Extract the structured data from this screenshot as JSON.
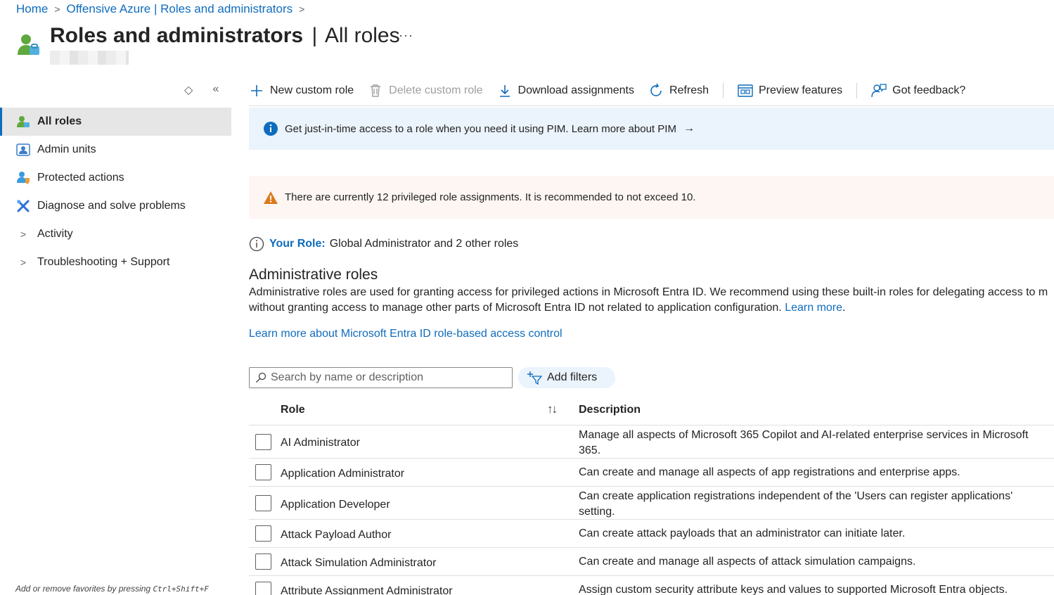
{
  "breadcrumb": {
    "home": "Home",
    "parent": "Offensive Azure | Roles and administrators"
  },
  "page": {
    "title_main": "Roles and administrators",
    "title_divider": "|",
    "title_sub": "All roles",
    "more": "···"
  },
  "nav": {
    "items": [
      {
        "label": "All roles",
        "icon": "roles-icon"
      },
      {
        "label": "Admin units",
        "icon": "admin-units-icon"
      },
      {
        "label": "Protected actions",
        "icon": "protected-actions-icon"
      },
      {
        "label": "Diagnose and solve problems",
        "icon": "wrench-icon"
      },
      {
        "label": "Activity",
        "icon": "chevron-right-icon"
      },
      {
        "label": "Troubleshooting + Support",
        "icon": "chevron-right-icon"
      }
    ],
    "hint_prefix": "Add or remove favorites by pressing",
    "hint_keys": "Ctrl+Shift+F"
  },
  "toolbar": {
    "new_custom_role": "New custom role",
    "delete_custom_role": "Delete custom role",
    "download_assignments": "Download assignments",
    "refresh": "Refresh",
    "preview_features": "Preview features",
    "got_feedback": "Got feedback?"
  },
  "banners": {
    "info": "Get just-in-time access to a role when you need it using PIM. Learn more about PIM",
    "info_arrow": "→",
    "warning": "There are currently 12 privileged role assignments. It is recommended to not exceed 10."
  },
  "your_role": {
    "label": "Your Role:",
    "value": "Global Administrator and 2 other roles"
  },
  "admin_roles": {
    "title": "Administrative roles",
    "desc_line1": "Administrative roles are used for granting access for privileged actions in Microsoft Entra ID. We recommend using these built-in roles for delegating access to m",
    "desc_line2": "without granting access to manage other parts of Microsoft Entra ID not related to application configuration.",
    "learn_more": "Learn more",
    "period": ".",
    "rbac_link": "Learn more about Microsoft Entra ID role-based access control"
  },
  "search": {
    "placeholder": "Search by name or description",
    "add_filters": "Add filters"
  },
  "table": {
    "col_role": "Role",
    "sort_icon": "↑↓",
    "col_desc": "Description",
    "rows": [
      {
        "role": "AI Administrator",
        "desc": "Manage all aspects of Microsoft 365 Copilot and AI-related enterprise services in Microsoft 365."
      },
      {
        "role": "Application Administrator",
        "desc": "Can create and manage all aspects of app registrations and enterprise apps."
      },
      {
        "role": "Application Developer",
        "desc": "Can create application registrations independent of the 'Users can register applications' setting."
      },
      {
        "role": "Attack Payload Author",
        "desc": "Can create attack payloads that an administrator can initiate later."
      },
      {
        "role": "Attack Simulation Administrator",
        "desc": "Can create and manage all aspects of attack simulation campaigns."
      },
      {
        "role": "Attribute Assignment Administrator",
        "desc": "Assign custom security attribute keys and values to supported Microsoft Entra objects."
      }
    ]
  },
  "colors": {
    "accent": "#0f6cbd",
    "info_bg": "#ebf3fc",
    "warn_bg": "#fdf6f3",
    "warn_icon": "#da7a1c"
  }
}
